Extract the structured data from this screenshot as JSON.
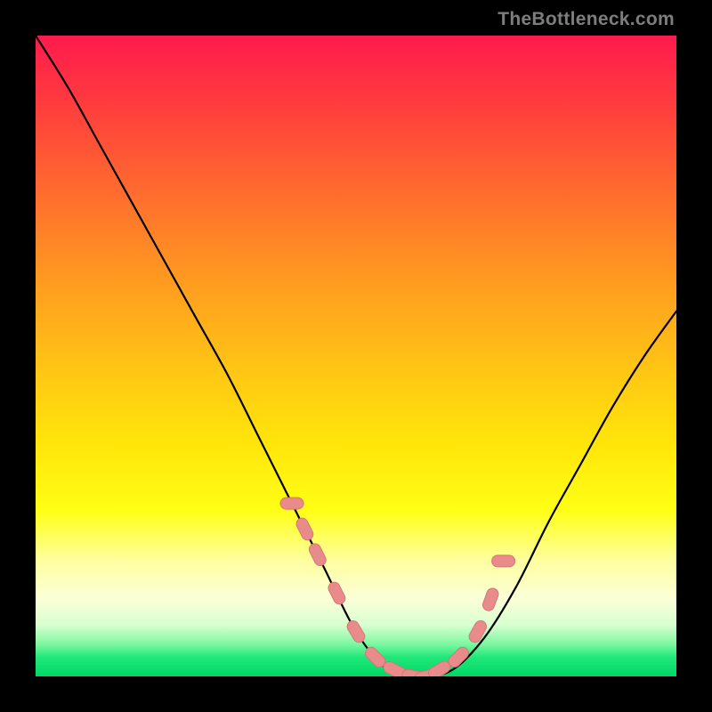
{
  "watermark": "TheBottleneck.com",
  "colors": {
    "background": "#000000",
    "curve_stroke": "#000000",
    "marker_fill": "#e98b8b",
    "marker_stroke": "#d87676",
    "gradient_stops": [
      "#ff1a4d",
      "#ff3a3f",
      "#ff6a2f",
      "#ff9a20",
      "#ffc515",
      "#ffe60a",
      "#ffff15",
      "#feffa0",
      "#fbffd8",
      "#d8ffd0",
      "#7cf7a0",
      "#20e87a",
      "#00d865"
    ]
  },
  "chart_data": {
    "type": "line",
    "title": "",
    "xlabel": "",
    "ylabel": "",
    "xlim": [
      0,
      100
    ],
    "ylim": [
      0,
      100
    ],
    "grid": false,
    "legend": false,
    "series": [
      {
        "name": "main-curve",
        "x": [
          0,
          5,
          10,
          15,
          20,
          25,
          30,
          35,
          40,
          45,
          50,
          55,
          60,
          65,
          70,
          75,
          80,
          85,
          90,
          95,
          100
        ],
        "y": [
          100,
          92,
          83,
          74,
          65,
          56,
          47,
          37,
          27,
          17,
          7,
          1,
          0,
          1,
          6,
          14,
          24,
          33,
          42,
          50,
          57
        ]
      }
    ],
    "markers": {
      "name": "highlight-points",
      "x": [
        40,
        42,
        44,
        47,
        50,
        53,
        56,
        59,
        61,
        63,
        66,
        69,
        71,
        73
      ],
      "y": [
        27,
        23,
        19,
        13,
        7,
        3,
        1,
        0,
        0,
        1,
        3,
        7,
        12,
        18
      ]
    }
  }
}
